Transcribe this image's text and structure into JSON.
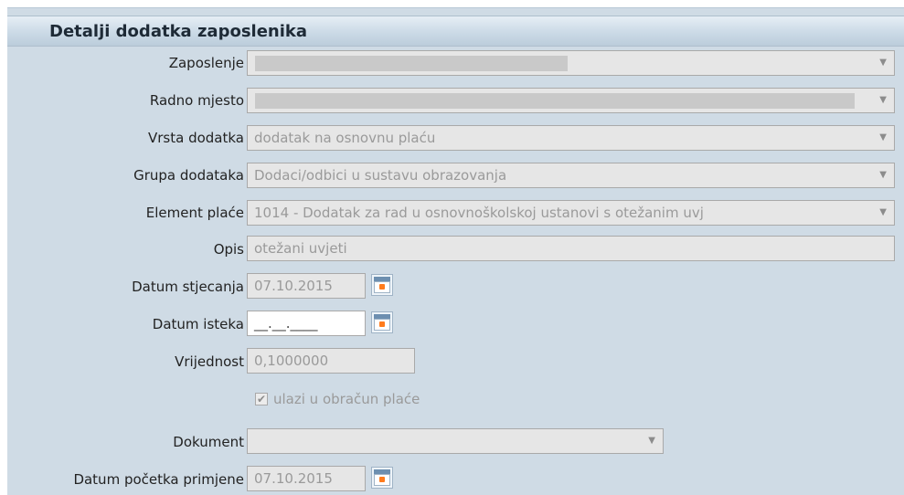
{
  "header": {
    "title": "Detalji dodatka zaposlenika"
  },
  "fields": {
    "zaposlenje": {
      "label": "Zaposlenje",
      "value": ""
    },
    "radno_mjesto": {
      "label": "Radno mjesto",
      "value": ""
    },
    "vrsta_dodatka": {
      "label": "Vrsta dodatka",
      "value": "dodatak na osnovnu plaću"
    },
    "grupa_dodataka": {
      "label": "Grupa dodataka",
      "value": "Dodaci/odbici u sustavu obrazovanja"
    },
    "element_place": {
      "label": "Element plaće",
      "value": "1014 - Dodatak za rad u osnovnoškolskoj ustanovi s otežanim uvj"
    },
    "opis": {
      "label": "Opis",
      "value": "otežani uvjeti"
    },
    "datum_stjecanja": {
      "label": "Datum stjecanja",
      "value": "07.10.2015"
    },
    "datum_isteka": {
      "label": "Datum isteka",
      "value": "__.__.____"
    },
    "vrijednost": {
      "label": "Vrijednost",
      "value": "0,1000000"
    },
    "ulazi_u_obracun": {
      "label": "ulazi u obračun plaće",
      "checked": true
    },
    "dokument": {
      "label": "Dokument",
      "value": ""
    },
    "datum_pocetka_primjene": {
      "label": "Datum početka primjene",
      "value": "07.10.2015"
    }
  },
  "icons": {
    "dropdown": "chevron-down-icon",
    "calendar": "calendar-icon",
    "checkmark": "checkmark-icon"
  },
  "colors": {
    "panel_bg": "#cfdbe5",
    "field_bg": "#e6e6e6",
    "calendar_accent": "#ff7b1c"
  }
}
